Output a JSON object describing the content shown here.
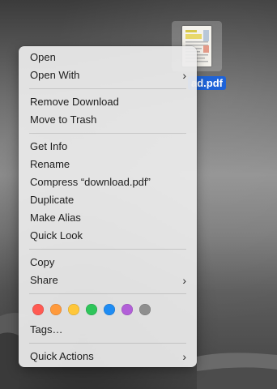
{
  "desktop": {
    "file_label": "ad.pdf",
    "file_icon": "pdf-thumbnail-icon"
  },
  "menu": {
    "groups": [
      [
        {
          "label": "Open",
          "submenu": false
        },
        {
          "label": "Open With",
          "submenu": true
        }
      ],
      [
        {
          "label": "Remove Download",
          "submenu": false
        },
        {
          "label": "Move to Trash",
          "submenu": false
        }
      ],
      [
        {
          "label": "Get Info",
          "submenu": false
        },
        {
          "label": "Rename",
          "submenu": false
        },
        {
          "label": "Compress “download.pdf”",
          "submenu": false
        },
        {
          "label": "Duplicate",
          "submenu": false
        },
        {
          "label": "Make Alias",
          "submenu": false
        },
        {
          "label": "Quick Look",
          "submenu": false
        }
      ],
      [
        {
          "label": "Copy",
          "submenu": false
        },
        {
          "label": "Share",
          "submenu": true
        }
      ]
    ],
    "tag_colors": [
      {
        "name": "red",
        "color": "#ff5a52"
      },
      {
        "name": "orange",
        "color": "#ff9a3c"
      },
      {
        "name": "yellow",
        "color": "#ffc73a"
      },
      {
        "name": "green",
        "color": "#2ec55a"
      },
      {
        "name": "blue",
        "color": "#1f8cf3"
      },
      {
        "name": "purple",
        "color": "#b25fd8"
      },
      {
        "name": "gray",
        "color": "#8e8e8e"
      }
    ],
    "tags_label": "Tags…",
    "quick_actions_label": "Quick Actions",
    "chevron": "›"
  }
}
